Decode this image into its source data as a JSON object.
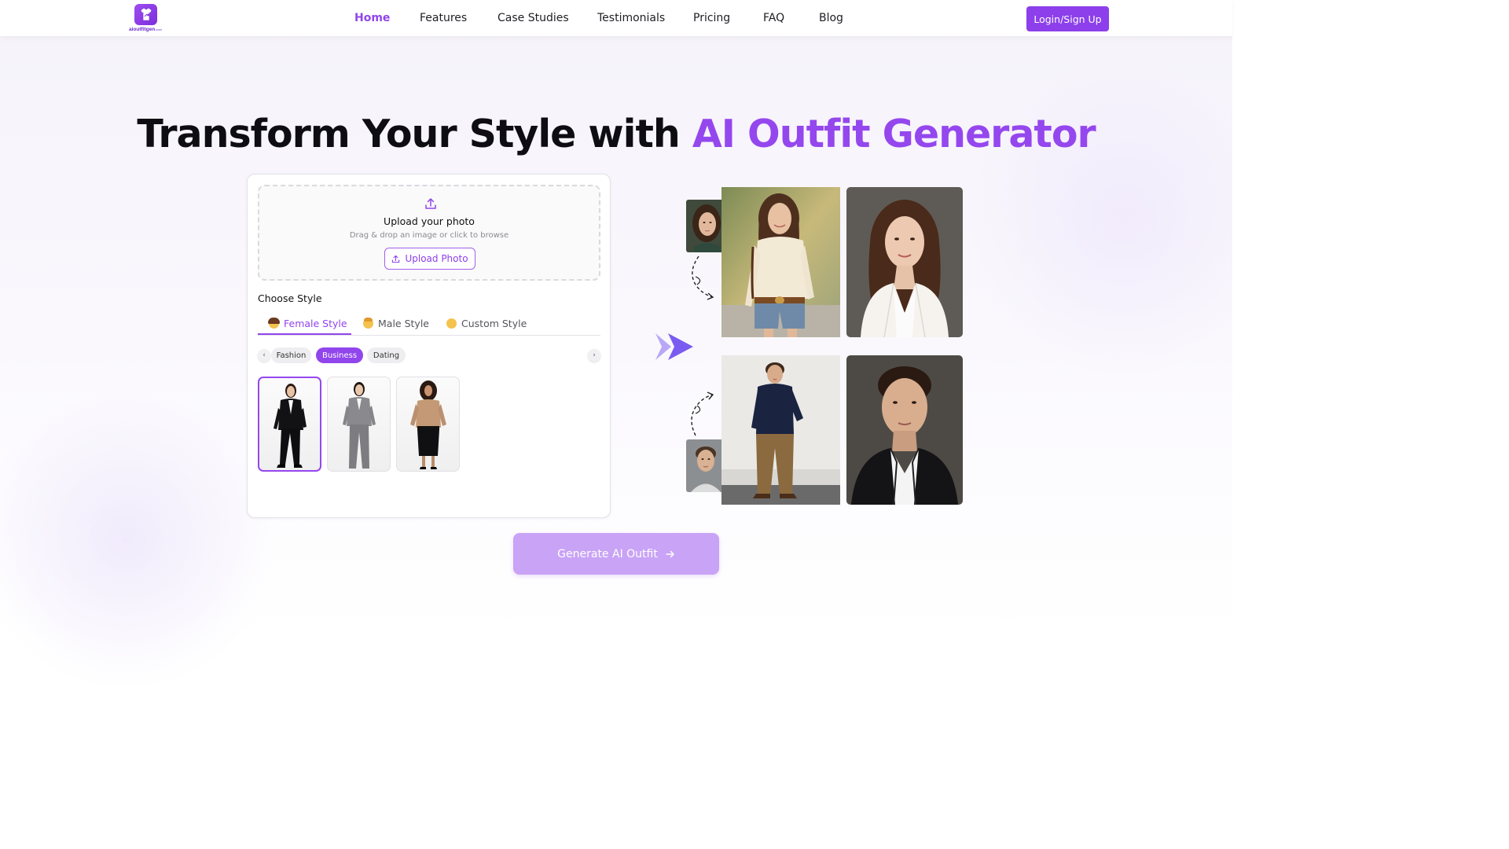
{
  "brand": {
    "logo_text": "aioutfitgen",
    "logo_suffix": ".com"
  },
  "nav": {
    "items": [
      {
        "label": "Home",
        "active": true
      },
      {
        "label": "Features"
      },
      {
        "label": "Case Studies"
      },
      {
        "label": "Testimonials"
      },
      {
        "label": "Pricing"
      },
      {
        "label": "FAQ"
      },
      {
        "label": "Blog"
      }
    ],
    "login_label": "Login/Sign Up"
  },
  "hero": {
    "title_plain": "Transform Your Style with ",
    "title_accent": "AI Outfit Generator"
  },
  "upload": {
    "title": "Upload your photo",
    "subtitle": "Drag & drop an image or click to browse",
    "button_label": "Upload Photo",
    "icon": "upload-icon"
  },
  "style": {
    "section_label": "Choose Style",
    "tabs": [
      {
        "label": "Female Style",
        "icon": "woman-emoji",
        "active": true
      },
      {
        "label": "Male Style",
        "icon": "man-emoji"
      },
      {
        "label": "Custom Style",
        "icon": "custom-emoji"
      }
    ],
    "categories": [
      {
        "label": "Fashion"
      },
      {
        "label": "Business",
        "active": true
      },
      {
        "label": "Dating"
      }
    ],
    "outfits": [
      {
        "name": "black-suit",
        "selected": true
      },
      {
        "name": "grey-suit"
      },
      {
        "name": "satin-blouse-pencil-skirt"
      }
    ]
  },
  "showcase": {
    "examples": [
      {
        "input": "woman-selfie",
        "source": "woman-casual-outfit",
        "result": "woman-white-blazer-portrait"
      },
      {
        "input": "man-selfie",
        "source": "man-casual-outfit",
        "result": "man-black-suit-portrait"
      }
    ]
  },
  "cta": {
    "label": "Generate AI Outfit",
    "icon": "arrow-right-icon"
  },
  "colors": {
    "accent": "#9145ec",
    "accent_light": "#c9a3f6",
    "button": "#8c3fea"
  }
}
